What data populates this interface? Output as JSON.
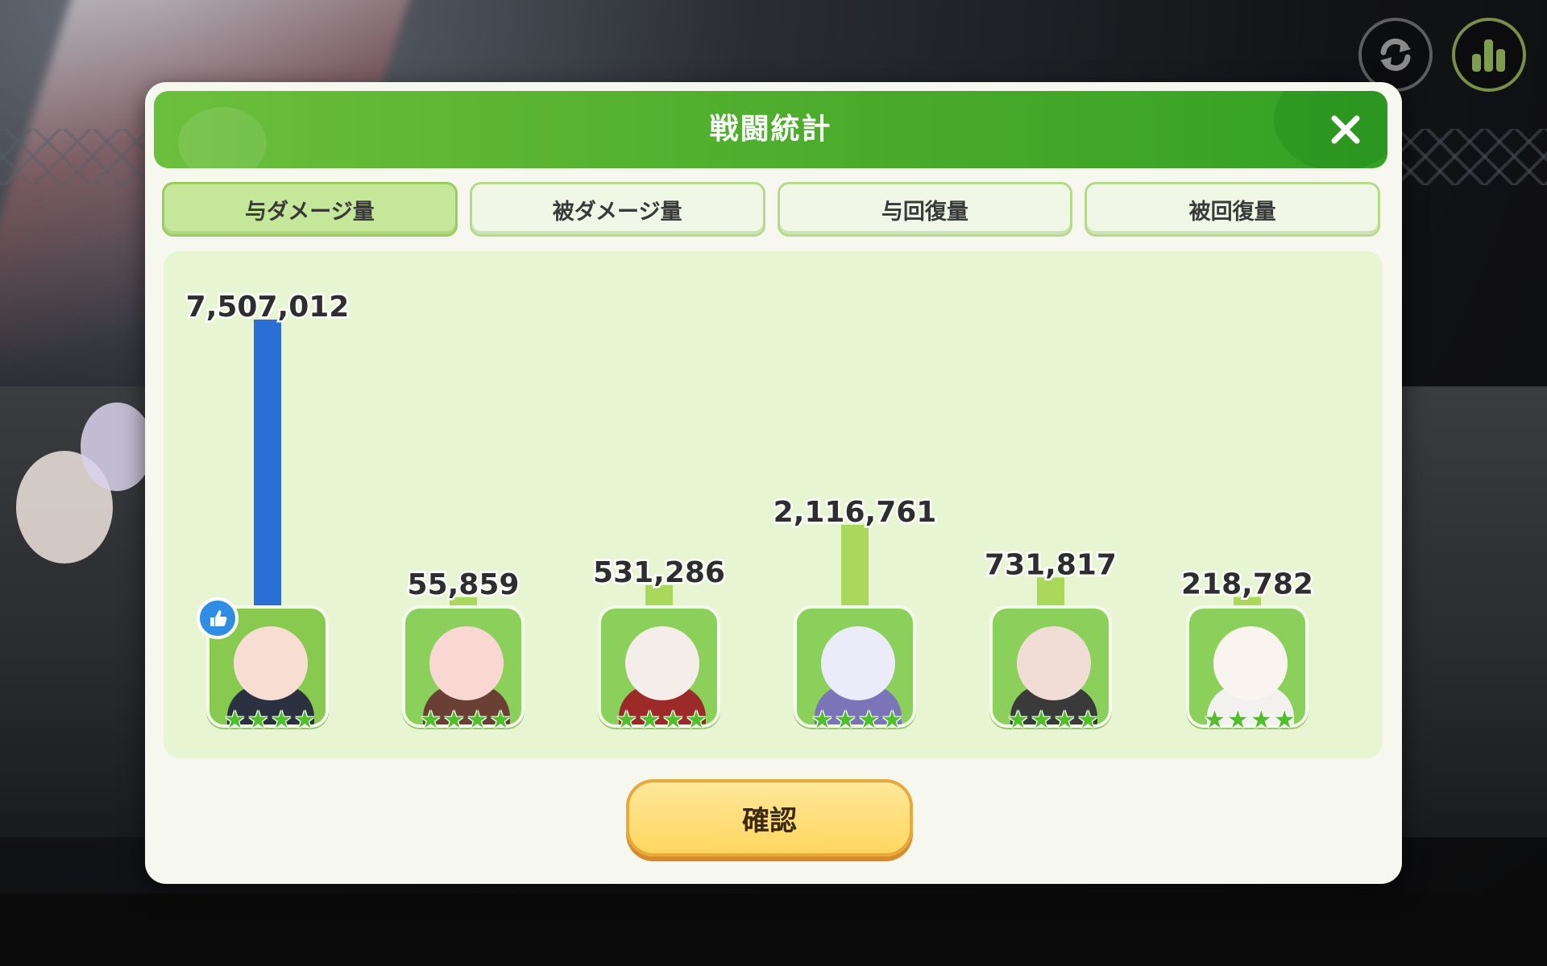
{
  "dialog": {
    "title": "戦闘統計",
    "confirm_label": "確認"
  },
  "tabs": [
    {
      "label": "与ダメージ量",
      "active": true
    },
    {
      "label": "被ダメージ量",
      "active": false
    },
    {
      "label": "与回復量",
      "active": false
    },
    {
      "label": "被回復量",
      "active": false
    }
  ],
  "icons": {
    "top_right_left": "refresh-icon",
    "top_right_right": "bar-chart-icon",
    "close": "close-icon",
    "mvp_badge": "thumbs-up-icon"
  },
  "colors": {
    "top_bar": "#2a6fd6",
    "other_bars": "#a9d85a",
    "header_green": "#49aa2a",
    "tab_active": "#c4e79a"
  },
  "characters": [
    {
      "rarity_stars": 4,
      "mvp": true
    },
    {
      "rarity_stars": 4,
      "mvp": false
    },
    {
      "rarity_stars": 4,
      "mvp": false
    },
    {
      "rarity_stars": 4,
      "mvp": false
    },
    {
      "rarity_stars": 4,
      "mvp": false
    },
    {
      "rarity_stars": 4,
      "mvp": false
    }
  ],
  "chart_data": {
    "type": "bar",
    "categories": [
      "",
      "",
      "",
      "",
      "",
      ""
    ],
    "values": [
      7507012,
      55859,
      531286,
      2116761,
      731817,
      218782
    ],
    "value_labels": [
      "7,507,012",
      "55,859",
      "531,286",
      "2,116,761",
      "731,817",
      "218,782"
    ],
    "ylim": [
      0,
      7507012
    ],
    "grid": false,
    "highlight_index": 0
  }
}
